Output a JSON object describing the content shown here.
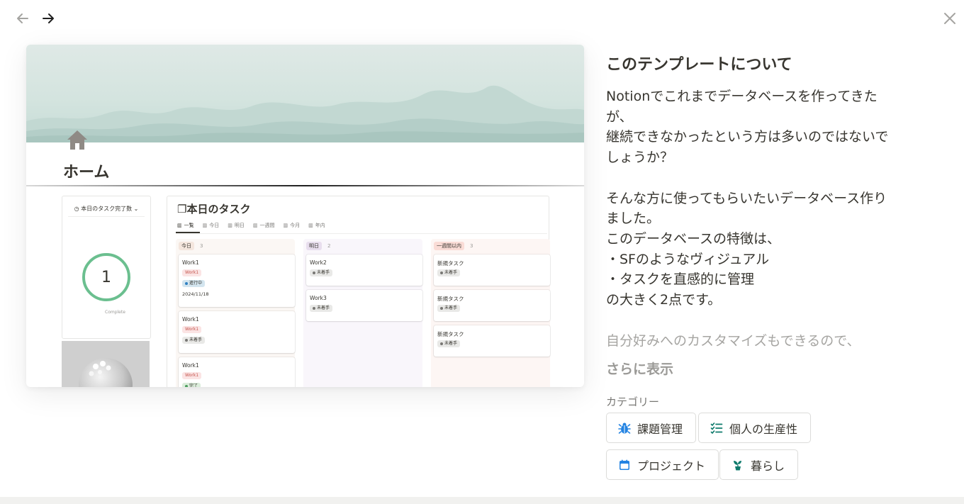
{
  "nav": {
    "back_icon": "arrow-left-icon",
    "forward_icon": "arrow-right-icon",
    "close_icon": "close-icon"
  },
  "preview": {
    "page_icon": "house-icon",
    "page_title": "ホーム",
    "side_card": {
      "title": "本日のタスク完了数",
      "value": "1",
      "caption": "Complete"
    },
    "board": {
      "title": "❐本日のタスク",
      "tabs": [
        "一覧",
        "今日",
        "明日",
        "一週間",
        "今月",
        "年内"
      ],
      "columns": [
        {
          "label": "今日",
          "count": "3",
          "tag_bg": "#f4e6dd",
          "bg": "#fbf7f4",
          "cards": [
            {
              "name": "Work1",
              "tag": "Work1",
              "status": "進行中",
              "status_bg": "#d3e5ef",
              "dot": "#2f80c2",
              "date": "2024/11/18"
            },
            {
              "name": "Work1",
              "tag": "Work1",
              "status": "未着手",
              "status_bg": "#e9e9e7",
              "dot": "#787774",
              "date": ""
            },
            {
              "name": "Work1",
              "tag": "Work1",
              "status": "完了",
              "status_bg": "#dbeddb",
              "dot": "#4b9e5e",
              "date": ""
            }
          ]
        },
        {
          "label": "明日",
          "count": "2",
          "tag_bg": "#e8deee",
          "bg": "#f9f6fb",
          "cards": [
            {
              "name": "Work2",
              "tag": "",
              "status": "未着手",
              "status_bg": "#e9e9e7",
              "dot": "#787774",
              "date": ""
            },
            {
              "name": "Work3",
              "tag": "",
              "status": "未着手",
              "status_bg": "#e9e9e7",
              "dot": "#787774",
              "date": ""
            }
          ]
        },
        {
          "label": "一週間以内",
          "count": "3",
          "tag_bg": "#fadcd6",
          "bg": "#fdf6f4",
          "cards": [
            {
              "name": "新規タスク",
              "tag": "",
              "status": "未着手",
              "status_bg": "#e9e9e7",
              "dot": "#787774",
              "date": ""
            },
            {
              "name": "新規タスク",
              "tag": "",
              "status": "未着手",
              "status_bg": "#e9e9e7",
              "dot": "#787774",
              "date": ""
            },
            {
              "name": "新規タスク",
              "tag": "",
              "status": "未着手",
              "status_bg": "#e9e9e7",
              "dot": "#787774",
              "date": ""
            }
          ]
        }
      ]
    }
  },
  "about": {
    "title": "このテンプレートについて",
    "description": "Notionでこれまでデータベースを作ってきたが、\n継続できなかったという方は多いのではないでしょうか？\n\nそんな方に使ってもらいたいデータベース作りました。\nこのデータベースの特徴は、\n・SFのようなヴィジュアル\n・タスクを直感的に管理\nの大きく2点です。",
    "description_faded": "自分好みへのカスタマイズもできるので、",
    "show_more": "さらに表示",
    "category_label": "カテゴリー",
    "categories": [
      {
        "label": "課題管理",
        "icon": "bug-icon",
        "color": "#2383e2"
      },
      {
        "label": "個人の生産性",
        "icon": "checklist-icon",
        "color": "#0f7b6c"
      },
      {
        "label": "プロジェクト",
        "icon": "calendar-icon",
        "color": "#2383e2"
      },
      {
        "label": "暮らし",
        "icon": "plant-icon",
        "color": "#0f7b6c"
      }
    ]
  }
}
